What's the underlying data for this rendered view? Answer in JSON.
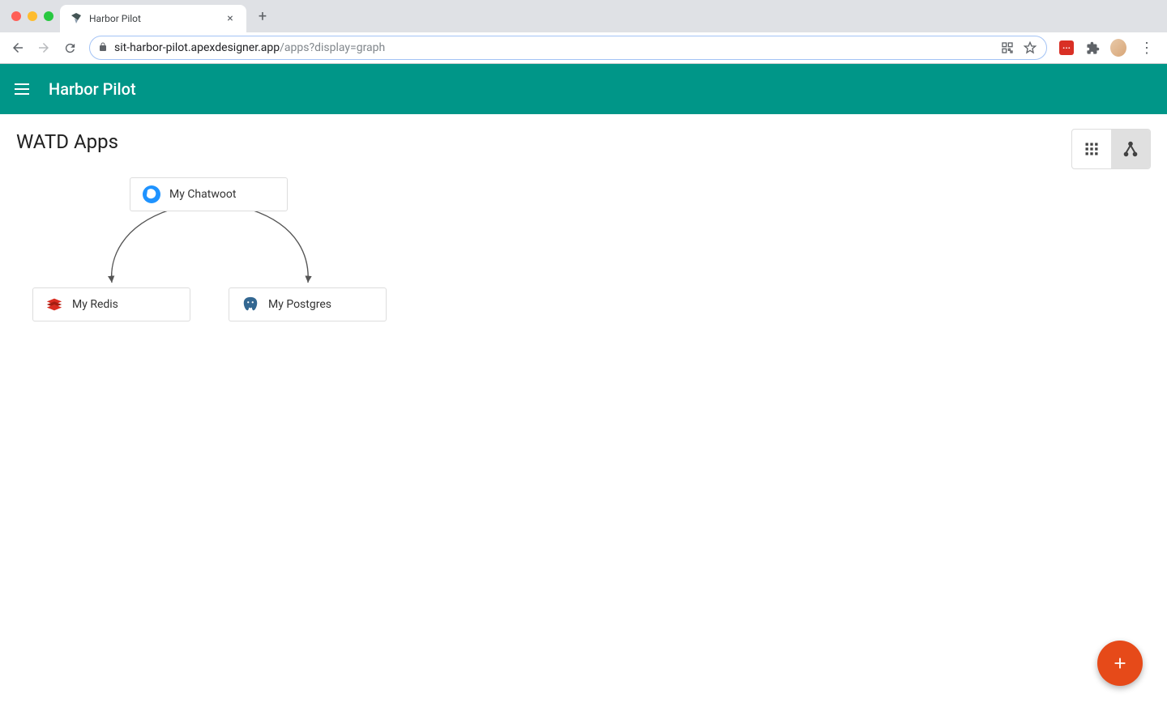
{
  "browser": {
    "tab_title": "Harbor Pilot",
    "url_host": "sit-harbor-pilot.apexdesigner.app",
    "url_path": "/apps?display=graph"
  },
  "app": {
    "title": "Harbor Pilot"
  },
  "page": {
    "title": "WATD Apps"
  },
  "nodes": {
    "chatwoot": {
      "label": "My Chatwoot"
    },
    "redis": {
      "label": "My Redis"
    },
    "postgres": {
      "label": "My Postgres"
    }
  },
  "chart_data": {
    "type": "diagram",
    "nodes": [
      {
        "id": "chatwoot",
        "label": "My Chatwoot"
      },
      {
        "id": "redis",
        "label": "My Redis"
      },
      {
        "id": "postgres",
        "label": "My Postgres"
      }
    ],
    "edges": [
      {
        "from": "chatwoot",
        "to": "redis"
      },
      {
        "from": "chatwoot",
        "to": "postgres"
      }
    ]
  }
}
